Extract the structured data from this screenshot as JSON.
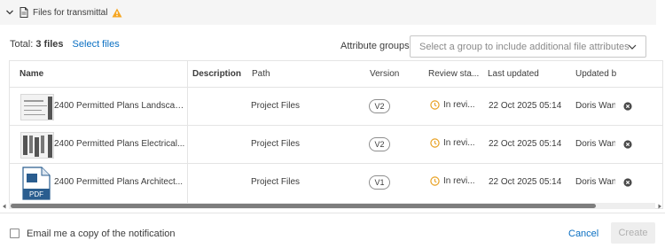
{
  "section": {
    "title": "Files for transmittal",
    "collapse_icon": "chevron-down-icon",
    "file_icon": "document-icon",
    "warning_icon": "warning-icon",
    "warning_color": "#f5a623"
  },
  "summary": {
    "total_label": "Total:",
    "total_count": "3 files",
    "select_files": "Select files"
  },
  "attribute_groups": {
    "label": "Attribute groups",
    "placeholder": "Select a group to include additional file attributes"
  },
  "table": {
    "columns": {
      "name": "Name",
      "description": "Description",
      "path": "Path",
      "version": "Version",
      "review_status": "Review sta...",
      "last_updated": "Last updated",
      "updated_by": "Updated b"
    },
    "rows": [
      {
        "name": "2400 Permitted Plans Landscap...",
        "description": "",
        "path": "Project Files",
        "version": "V2",
        "review_status": "In revi...",
        "last_updated": "22 Oct 2025 05:14",
        "updated_by": "Doris Wan",
        "thumbnail": "landscape-drawing"
      },
      {
        "name": "2400 Permitted Plans Electrical...",
        "description": "",
        "path": "Project Files",
        "version": "V2",
        "review_status": "In revi...",
        "last_updated": "22 Oct 2025 05:14",
        "updated_by": "Doris Wan",
        "thumbnail": "electrical-drawing"
      },
      {
        "name": "2400 Permitted Plans Architect...",
        "description": "",
        "path": "Project Files",
        "version": "V1",
        "review_status": "In revi...",
        "last_updated": "22 Oct 2025 05:14",
        "updated_by": "Doris Wan",
        "thumbnail": "pdf",
        "thumbnail_label": "PDF"
      }
    ],
    "review_icon_color": "#e8a020"
  },
  "footer": {
    "email_copy_label": "Email me a copy of the notification",
    "email_copy_checked": false,
    "cancel_label": "Cancel",
    "create_label": "Create"
  },
  "colors": {
    "link": "#0a6fc2",
    "header_bg": "#f5f5f5",
    "disabled_bg": "#eeeeee",
    "disabled_text": "#b0b0b0"
  }
}
